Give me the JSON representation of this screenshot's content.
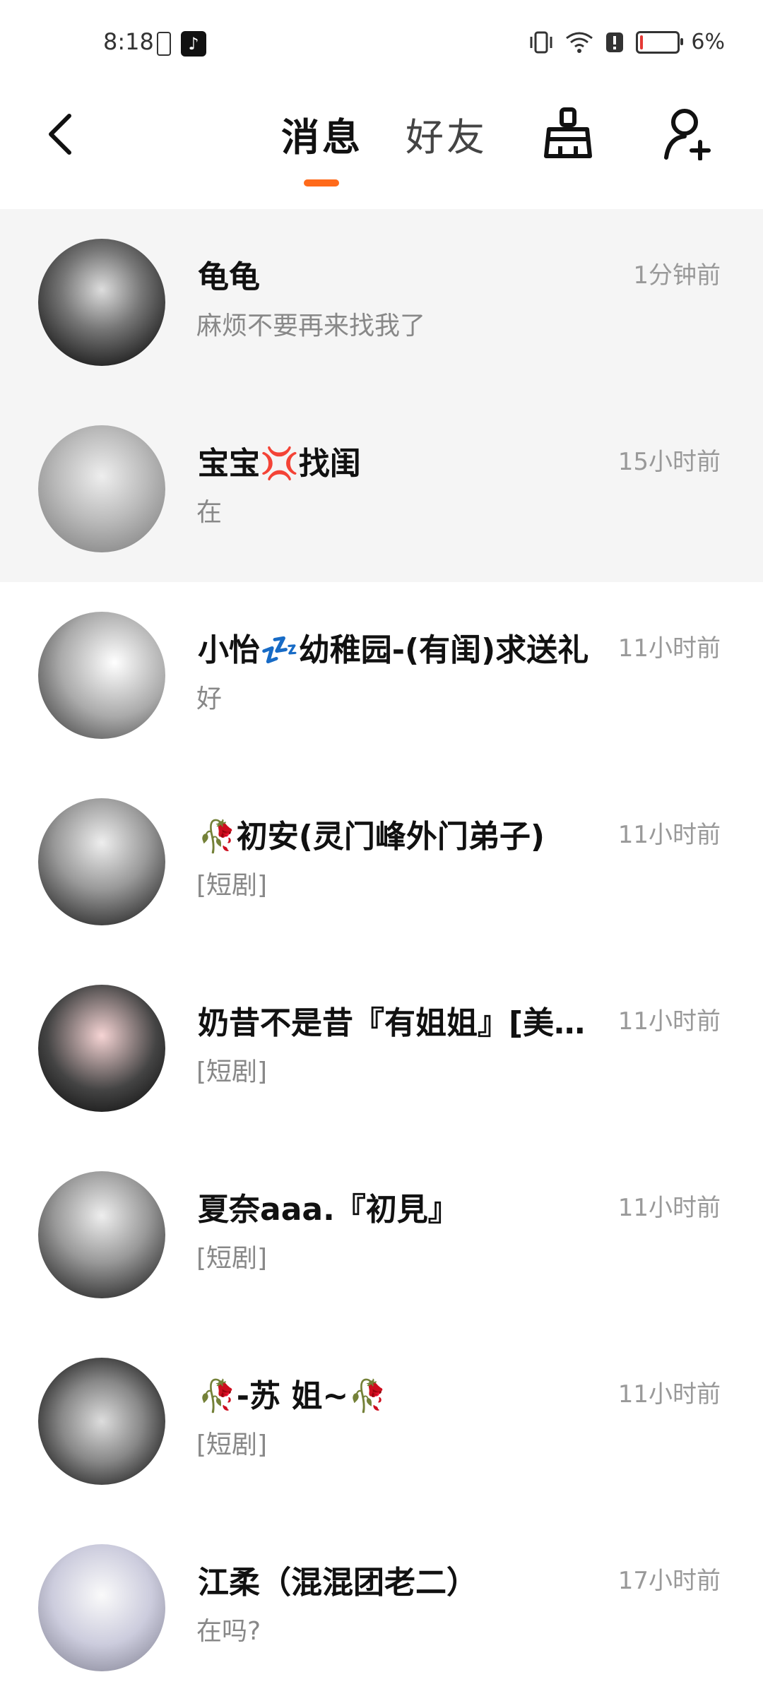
{
  "status": {
    "time": "8:18",
    "battery": "6%",
    "battery_level": 0.06,
    "tiktok_glyph": "♪",
    "battery_color": "#e53935"
  },
  "header": {
    "tab_active": "消息",
    "tab_inactive": "好友",
    "accent_color": "#ff6a1a",
    "icons": [
      "back-icon",
      "broom-icon",
      "add-friend-icon"
    ]
  },
  "conversations": [
    {
      "name": "龟龟",
      "preview": "麻烦不要再来找我了",
      "time": "1分钟前",
      "pinned": true
    },
    {
      "name": "宝宝💢找闺",
      "preview": "在",
      "time": "15小时前",
      "pinned": true
    },
    {
      "name": "小怡💤幼稚园-(有闺)求送礼",
      "preview": "好",
      "time": "11小时前",
      "pinned": false
    },
    {
      "name": "🥀初安(灵门峰外门弟子)",
      "preview": "[短剧]",
      "time": "11小时前",
      "pinned": false
    },
    {
      "name": "奶昔不是昔『有姐姐』[美…",
      "preview": "[短剧]",
      "time": "11小时前",
      "pinned": false
    },
    {
      "name": "夏奈aaa.『初見』",
      "preview": "[短剧]",
      "time": "11小时前",
      "pinned": false
    },
    {
      "name": "🥀-苏 姐~🥀",
      "preview": "[短剧]",
      "time": "11小时前",
      "pinned": false
    },
    {
      "name": "江柔（混混团老二）",
      "preview": "在吗?",
      "time": "17小时前",
      "pinned": false
    }
  ]
}
